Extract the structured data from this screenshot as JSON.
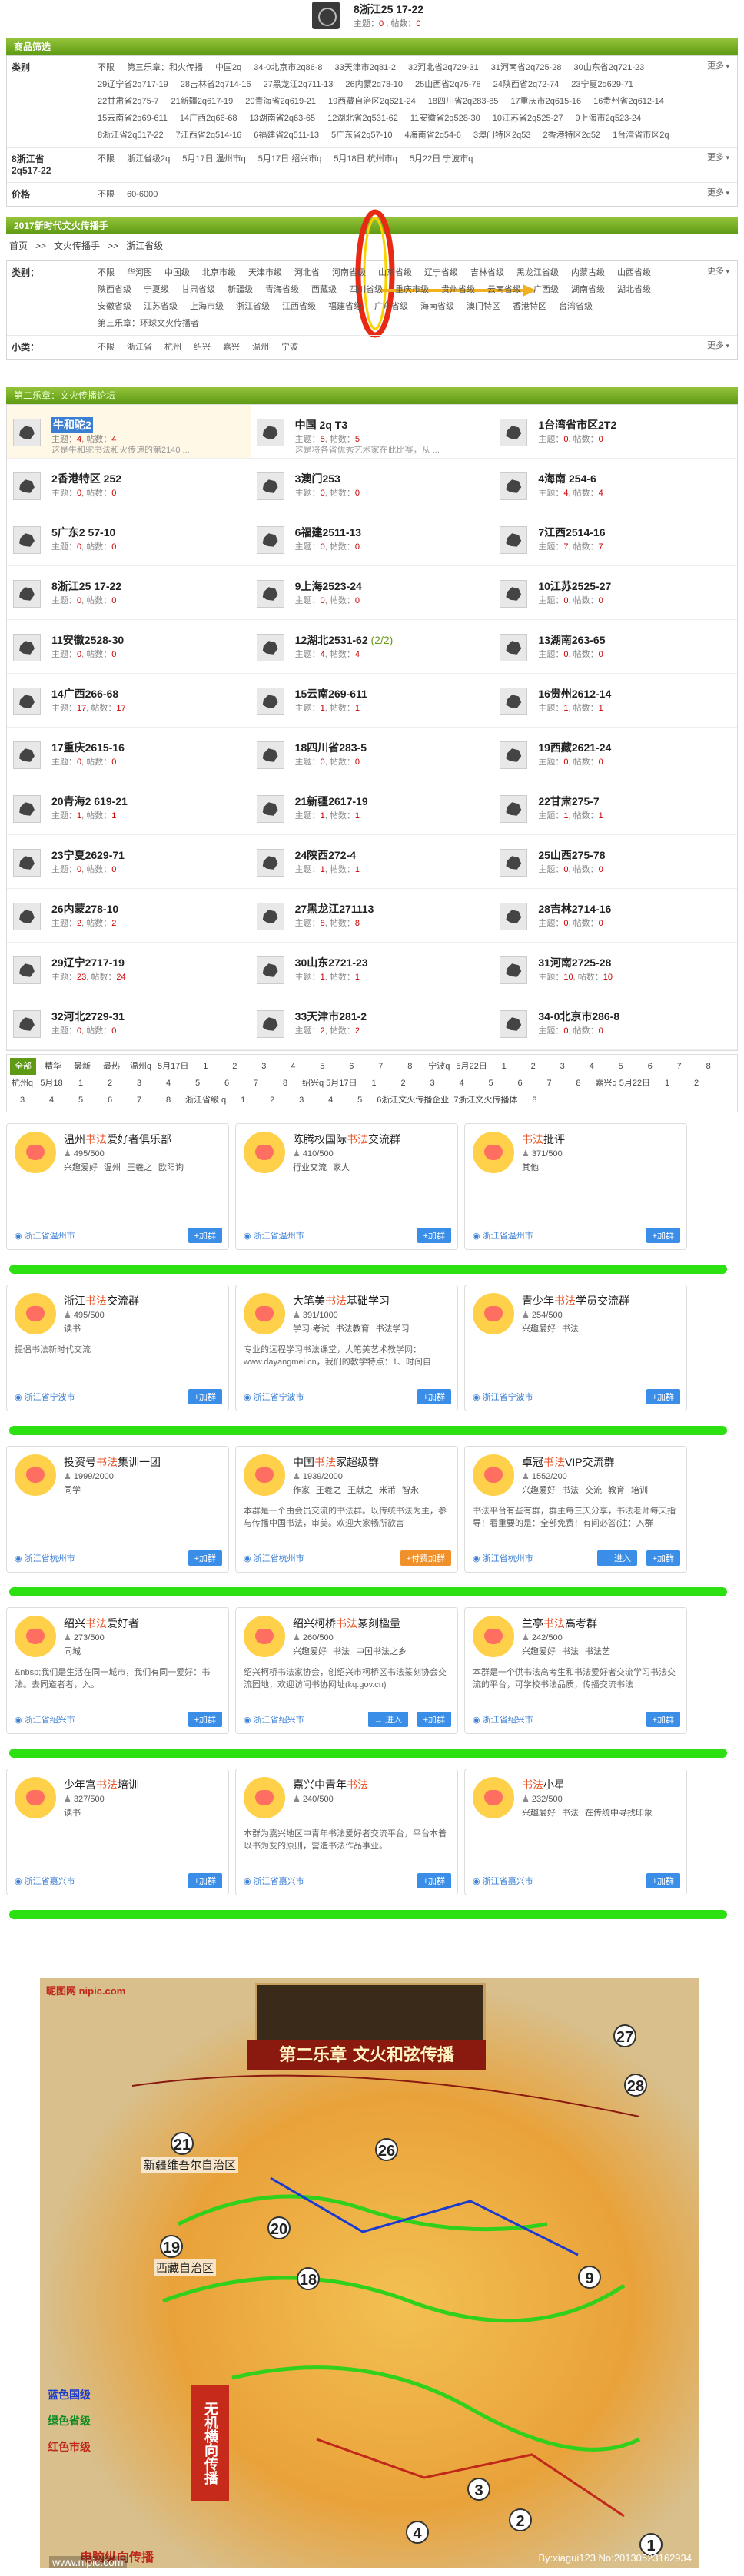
{
  "header": {
    "title": "8浙江25 17-22",
    "meta_topics_label": "主题：",
    "meta_topics": "0",
    "meta_posts_label": "帖数：",
    "meta_posts": "0"
  },
  "filter_title": "商品筛选",
  "filter": {
    "category_label": "类别",
    "category_options": [
      "不限",
      "第三乐章：和火传播",
      "中国2q",
      "34-0北京市2q86-8",
      "33天津市2q81-2",
      "32河北省2q729-31",
      "31河南省2q725-28",
      "30山东省2q721-23",
      "29辽宁省2q717-19",
      "28吉林省2q714-16",
      "27黑龙江2q711-13",
      "26内蒙2q78-10",
      "25山西省2q75-78",
      "24陕西省2q72-74",
      "23宁夏2q629-71",
      "22甘肃省2q75-7",
      "21新疆2q617-19",
      "20青海省2q619-21",
      "19西藏自治区2q621-24",
      "18四川省2q283-85",
      "17重庆市2q615-16",
      "16贵州省2q612-14",
      "15云南省2q69-611",
      "14广西2q66-68",
      "13湖南省2q63-65",
      "12湖北省2q531-62",
      "11安徽省2q528-30",
      "10江苏省2q525-27",
      "9上海市2q523-24",
      "8浙江省2q517-22",
      "7江西省2q514-16",
      "6福建省2q511-13",
      "5广东省2q57-10",
      "4海南省2q54-6",
      "3澳门特区2q53",
      "2香港特区2q52",
      "1台湾省市区2q"
    ],
    "category_more": "更多",
    "date_label": "8浙江省",
    "date_sub": "2q517-22",
    "date_options": [
      "不限",
      "浙江省级2q",
      "5月17日 温州市q",
      "5月17日 绍兴市q",
      "5月18日 杭州市q",
      "5月22日 宁波市q"
    ],
    "date_more": "更多",
    "price_label": "价格",
    "price_options": [
      "不限",
      "60-6000"
    ],
    "price_more": "更多"
  },
  "section2_title": "2017新时代文火传播手",
  "breadcrumb": {
    "items": [
      "首页",
      ">>",
      "文火传播手",
      ">>",
      "浙江省级"
    ]
  },
  "filter2": {
    "category_label": "类别：",
    "category_options": [
      "不限",
      "华河图",
      "中国级",
      "北京市级",
      "天津市级",
      "河北省",
      "河南省级",
      "山东省级",
      "辽宁省级",
      "吉林省级",
      "黑龙江省级",
      "内蒙古级",
      "山西省级",
      "陕西省级",
      "宁夏级",
      "甘肃省级",
      "新疆级",
      "青海省级",
      "西藏级",
      "四川省级",
      "重庆市级",
      "贵州省级",
      "云南省级",
      "广西级",
      "湖南省级",
      "湖北省级",
      "安徽省级",
      "江苏省级",
      "上海市级",
      "浙江省级",
      "江西省级",
      "福建省级",
      "广东省级",
      "海南省级",
      "澳门特区",
      "香港特区",
      "台湾省级",
      "第三乐章：环球文火传播者"
    ],
    "category_more": "更多",
    "sub_label": "小类：",
    "sub_options": [
      "不限",
      "浙江省",
      "杭州",
      "绍兴",
      "嘉兴",
      "温州",
      "宁波"
    ],
    "sub_more": "更多"
  },
  "forum_head": "第二乐章：文火传播论坛",
  "forums": [
    {
      "name": "牛和驼2",
      "extra": "",
      "topics": "4",
      "posts": "4",
      "desc": "这是牛和驼书法和火传递的第2140 ..."
    },
    {
      "name": "中国 2q T3",
      "extra": "",
      "topics": "5",
      "posts": "5",
      "desc": "这是将各省优秀艺术家在此比赛，从 ..."
    },
    {
      "name": "1台湾省市区2T2",
      "extra": "",
      "topics": "0",
      "posts": "0",
      "desc": ""
    },
    {
      "name": "2香港特区 252",
      "extra": "",
      "topics": "0",
      "posts": "0",
      "desc": ""
    },
    {
      "name": "3澳门253",
      "extra": "",
      "topics": "0",
      "posts": "0",
      "desc": ""
    },
    {
      "name": "4海南 254-6",
      "extra": "",
      "topics": "4",
      "posts": "4",
      "desc": ""
    },
    {
      "name": "5广东2 57-10",
      "extra": "",
      "topics": "0",
      "posts": "0",
      "desc": ""
    },
    {
      "name": "6福建2511-13",
      "extra": "",
      "topics": "0",
      "posts": "0",
      "desc": ""
    },
    {
      "name": "7江西2514-16",
      "extra": "",
      "topics": "7",
      "posts": "7",
      "desc": ""
    },
    {
      "name": "8浙江25 17-22",
      "extra": "",
      "topics": "0",
      "posts": "0",
      "desc": ""
    },
    {
      "name": "9上海2523-24",
      "extra": "",
      "topics": "0",
      "posts": "0",
      "desc": ""
    },
    {
      "name": "10江苏2525-27",
      "extra": "",
      "topics": "0",
      "posts": "0",
      "desc": ""
    },
    {
      "name": "11安徽2528-30",
      "extra": "",
      "topics": "0",
      "posts": "0",
      "desc": ""
    },
    {
      "name": "12湖北2531-62",
      "extra": "(2/2)",
      "topics": "4",
      "posts": "4",
      "desc": ""
    },
    {
      "name": "13湖南263-65",
      "extra": "",
      "topics": "0",
      "posts": "0",
      "desc": ""
    },
    {
      "name": "14广西266-68",
      "extra": "",
      "topics": "17",
      "posts": "17",
      "desc": ""
    },
    {
      "name": "15云南269-611",
      "extra": "",
      "topics": "1",
      "posts": "1",
      "desc": ""
    },
    {
      "name": "16贵州2612-14",
      "extra": "",
      "topics": "1",
      "posts": "1",
      "desc": ""
    },
    {
      "name": "17重庆2615-16",
      "extra": "",
      "topics": "0",
      "posts": "0",
      "desc": ""
    },
    {
      "name": "18四川省283-5",
      "extra": "",
      "topics": "0",
      "posts": "0",
      "desc": ""
    },
    {
      "name": "19西藏2621-24",
      "extra": "",
      "topics": "0",
      "posts": "0",
      "desc": ""
    },
    {
      "name": "20青海2 619-21",
      "extra": "",
      "topics": "1",
      "posts": "1",
      "desc": ""
    },
    {
      "name": "21新疆2617-19",
      "extra": "",
      "topics": "1",
      "posts": "1",
      "desc": ""
    },
    {
      "name": "22甘肃275-7",
      "extra": "",
      "topics": "1",
      "posts": "1",
      "desc": ""
    },
    {
      "name": "23宁夏2629-71",
      "extra": "",
      "topics": "0",
      "posts": "0",
      "desc": ""
    },
    {
      "name": "24陕西272-4",
      "extra": "",
      "topics": "1",
      "posts": "1",
      "desc": ""
    },
    {
      "name": "25山西275-78",
      "extra": "",
      "topics": "0",
      "posts": "0",
      "desc": ""
    },
    {
      "name": "26内蒙278-10",
      "extra": "",
      "topics": "2",
      "posts": "2",
      "desc": ""
    },
    {
      "name": "27黑龙江271113",
      "extra": "",
      "topics": "8",
      "posts": "8",
      "desc": ""
    },
    {
      "name": "28吉林2714-16",
      "extra": "",
      "topics": "0",
      "posts": "0",
      "desc": ""
    },
    {
      "name": "29辽宁2717-19",
      "extra": "",
      "topics": "23",
      "posts": "24",
      "desc": ""
    },
    {
      "name": "30山东2721-23",
      "extra": "",
      "topics": "1",
      "posts": "1",
      "desc": ""
    },
    {
      "name": "31河南2725-28",
      "extra": "",
      "topics": "10",
      "posts": "10",
      "desc": ""
    },
    {
      "name": "32河北2729-31",
      "extra": "",
      "topics": "0",
      "posts": "0",
      "desc": ""
    },
    {
      "name": "33天津市281-2",
      "extra": "",
      "topics": "2",
      "posts": "2",
      "desc": ""
    },
    {
      "name": "34-0北京市286-8",
      "extra": "",
      "topics": "0",
      "posts": "0",
      "desc": ""
    }
  ],
  "forum_stat_topics": "主题：",
  "forum_stat_posts": "帖数：",
  "tabs": [
    "全部",
    "精华",
    "最新",
    "最热",
    "温州q",
    "5月17日",
    "1",
    "2",
    "3",
    "4",
    "5",
    "6",
    "7",
    "8",
    "宁波q",
    "5月22日",
    "1",
    "2",
    "3",
    "4",
    "5",
    "6",
    "7",
    "8",
    "杭州q",
    "5月18",
    "1",
    "2",
    "3",
    "4",
    "5",
    "6",
    "7",
    "8",
    "绍兴q 5月17日",
    "1",
    "2",
    "3",
    "4",
    "5",
    "6",
    "7",
    "8",
    "嘉兴q 5月22日",
    "1",
    "2",
    "3",
    "4",
    "5",
    "6",
    "7",
    "8",
    "浙江省级 q",
    "1",
    "2",
    "3",
    "4",
    "5",
    "6浙江文火传播企业",
    "7浙江文火传播体",
    "8"
  ],
  "cards": [
    {
      "name": "温州书法爱好者俱乐部",
      "hl": "书法",
      "num": "495/500",
      "tags": [
        "兴趣爱好",
        "温州",
        "王羲之",
        "欧阳询"
      ],
      "desc": "",
      "loc": "浙江省温州市",
      "btn": "加群"
    },
    {
      "name": "陈腾权国际书法交流群",
      "hl": "书法",
      "num": "410/500",
      "tags": [
        "行业交流",
        "家人"
      ],
      "desc": "",
      "loc": "浙江省温州市",
      "btn": "加群"
    },
    {
      "name": "书法批评",
      "hl": "书法",
      "num": "371/500",
      "tags": [
        "其他"
      ],
      "desc": "",
      "loc": "浙江省温州市",
      "btn": "加群"
    },
    {
      "name": "浙江书法交流群",
      "hl": "书法",
      "num": "495/500",
      "tags": [
        "读书"
      ],
      "desc": "提倡书法新时代交流",
      "loc": "浙江省宁波市",
      "btn": "加群"
    },
    {
      "name": "大笔美书法基础学习",
      "hl": "书法",
      "num": "391/1000",
      "tags": [
        "学习·考试",
        "书法教育",
        "书法学习"
      ],
      "desc": "专业的远程学习书法课堂，大笔美艺术教学网：www.dayangmei.cn，我们的教学特点：1、时间自",
      "loc": "浙江省宁波市",
      "btn": "加群"
    },
    {
      "name": "青少年书法学员交流群",
      "hl": "书法",
      "num": "254/500",
      "tags": [
        "兴趣爱好",
        "书法"
      ],
      "desc": "",
      "loc": "浙江省宁波市",
      "btn": "加群"
    },
    {
      "name": "投资号书法集训一团",
      "hl": "书法",
      "num": "1999/2000",
      "tags": [
        "同学"
      ],
      "desc": "",
      "loc": "浙江省杭州市",
      "btn": "加群"
    },
    {
      "name": "中国书法家超级群",
      "hl": "书法",
      "num": "1939/2000",
      "tags": [
        "作家",
        "王羲之",
        "王献之",
        "米芾",
        "智永"
      ],
      "desc": "本群是一个由会员交流的书法群。以传统书法为主，参与传播中国书法，审美。欢迎大家畅所欲言",
      "loc": "浙江省杭州市",
      "btn": "付费加群"
    },
    {
      "name": "卓冠书法VIP交流群",
      "hl": "书法",
      "num": "1552/200",
      "tags": [
        "兴趣爱好",
        "书法",
        "交流",
        "教育",
        "培训"
      ],
      "desc": "书法平台有些有群，群主每三天分享，书法老师每天指导！看重要的是：全部免费！有问必答(注：入群",
      "loc": "浙江省杭州市",
      "btn": "加群",
      "into": "进入"
    },
    {
      "name": "绍兴书法爱好者",
      "hl": "书法",
      "num": "273/500",
      "tags": [
        "同城"
      ],
      "desc": "&nbsp;我们是生活在同一城市，我们有同一爱好：书法。去同道者者，入。",
      "loc": "浙江省绍兴市",
      "btn": "加群"
    },
    {
      "name": "绍兴柯桥书法篆刻楹量",
      "hl": "书法",
      "num": "260/500",
      "tags": [
        "兴趣爱好",
        "书法",
        "中国书法之乡"
      ],
      "desc": "绍兴柯桥书法家协会，创绍兴市柯桥区书法篆刻协会交流园地，欢迎访问书协网址(kq.gov.cn)",
      "loc": "浙江省绍兴市",
      "btn": "加群",
      "into": "进入"
    },
    {
      "name": "兰亭书法高考群",
      "hl": "书法",
      "num": "242/500",
      "tags": [
        "兴趣爱好",
        "书法",
        "书法艺"
      ],
      "desc": "本群是一个供书法高考生和书法爱好者交流学习书法交流的平台，可学校书法品质，传播交流书法",
      "loc": "浙江省绍兴市",
      "btn": "加群"
    },
    {
      "name": "少年宫书法培训",
      "hl": "书法",
      "num": "327/500",
      "tags": [
        "读书"
      ],
      "desc": "",
      "loc": "浙江省嘉兴市",
      "btn": "加群"
    },
    {
      "name": "嘉兴中青年书法",
      "hl": "书法",
      "num": "240/500",
      "tags": [],
      "desc": "本群为嘉兴地区中青年书法爱好者交流平台，平台本着以书为友的原则，营造书法作品事业。",
      "loc": "浙江省嘉兴市",
      "btn": "加群"
    },
    {
      "name": "书法小星",
      "hl": "书法",
      "num": "232/500",
      "tags": [
        "兴趣爱好",
        "书法",
        "在传统中寻找印象"
      ],
      "desc": "",
      "loc": "浙江省嘉兴市",
      "btn": "加群"
    }
  ],
  "num_prefix": "",
  "map": {
    "logo": "昵图网 nipic.com",
    "ribbon": "第二乐章  文火和弦传播",
    "labels": [
      "新疆维吾尔自治区",
      "西藏自治区"
    ],
    "numbers": [
      "27",
      "28",
      "26",
      "21",
      "20",
      "19",
      "18",
      "9",
      "4",
      "3",
      "2",
      "1"
    ],
    "legend": [
      "蓝色国级",
      "绿色省级",
      "红色市级"
    ],
    "side": "无机横向传播",
    "foot": "电脑纵向传播",
    "footer_url": "www.nipic.com",
    "watermark": "By:xiagui123  No:20130523162934"
  }
}
